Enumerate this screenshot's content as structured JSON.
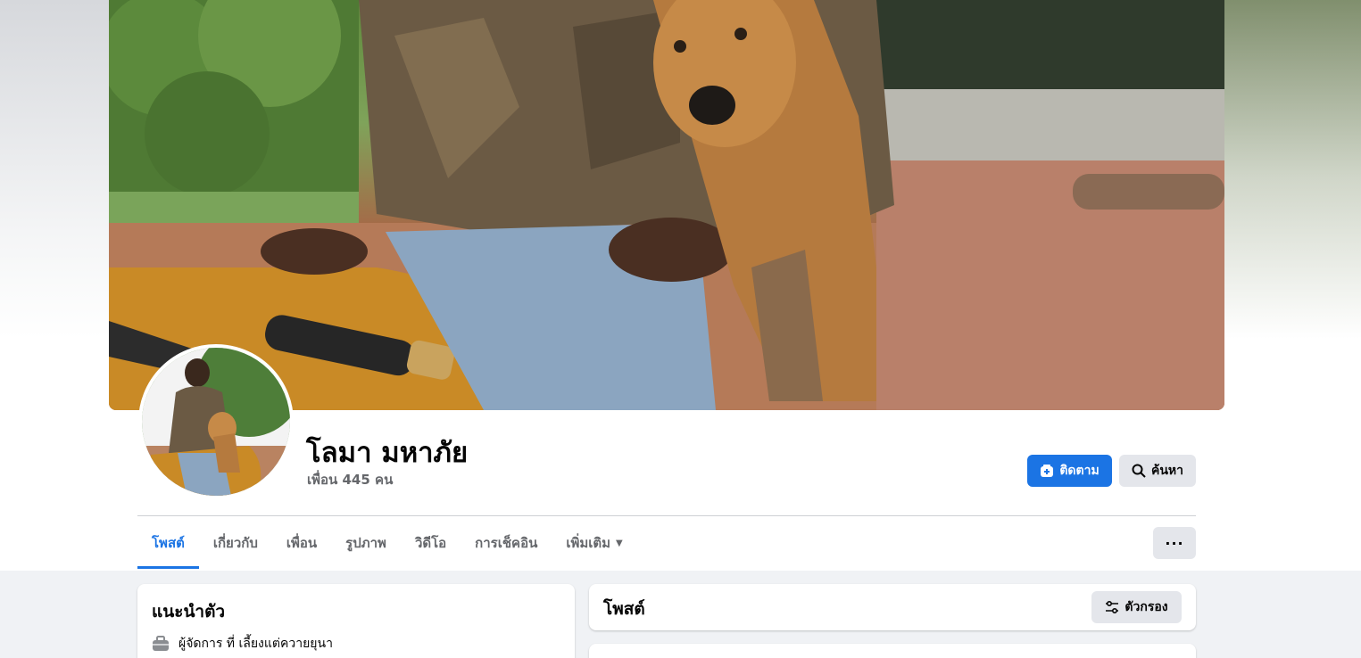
{
  "profile": {
    "name": "โลมา มหาภัย",
    "friends_text": "เพื่อน 445 คน"
  },
  "actions": {
    "follow_label": "ติดตาม",
    "search_label": "ค้นหา",
    "more_label": "···"
  },
  "tabs": [
    {
      "label": "โพสต์",
      "active": true
    },
    {
      "label": "เกี่ยวกับ",
      "active": false
    },
    {
      "label": "เพื่อน",
      "active": false
    },
    {
      "label": "รูปภาพ",
      "active": false
    },
    {
      "label": "วิดีโอ",
      "active": false
    },
    {
      "label": "การเช็คอิน",
      "active": false
    },
    {
      "label": "เพิ่มเติม",
      "active": false
    }
  ],
  "intro": {
    "title": "แนะนำตัว",
    "work": "ผู้จัดการ ที่ เลี้ยงแต่ควายยุนา"
  },
  "posts": {
    "title": "โพสต์",
    "filter_label": "ตัวกรอง"
  },
  "colors": {
    "accent": "#1b74e4",
    "button_gray": "#e4e6eb",
    "secondary_text": "#65676b"
  },
  "icons": {
    "follow": "add-friend-icon",
    "search": "search-icon",
    "more": "ellipsis-icon",
    "dropdown": "caret-down-icon",
    "work": "briefcase-icon",
    "filter": "filter-sliders-icon"
  }
}
